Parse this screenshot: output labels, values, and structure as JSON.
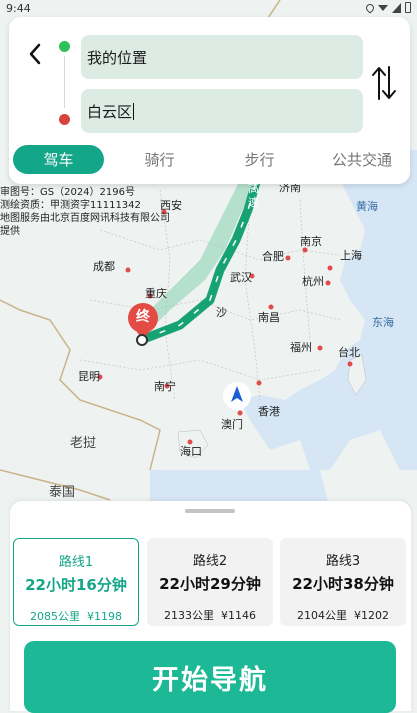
{
  "status": {
    "time": "9:44"
  },
  "search": {
    "from": "我的位置",
    "to": "白云区"
  },
  "tabs": [
    "驾车",
    "骑行",
    "步行",
    "公共交通"
  ],
  "map": {
    "copyright": [
      "审图号：GS（2024）2196号",
      "测绘资质：甲测资字11111342",
      "地图服务由北京百度网讯科技有限公司",
      "提供"
    ],
    "cities": {
      "xian": "西安",
      "chengdu": "成都",
      "chongqing": "重庆",
      "nanjing": "南京",
      "hefei": "合肥",
      "shanghai": "上海",
      "hangzhou": "杭州",
      "nanchang": "南昌",
      "wuhan": "武汉",
      "changsha": "沙",
      "fuzhou": "福州",
      "taibei": "台北",
      "kunming": "昆明",
      "nanning": "南宁",
      "aomen": "澳门",
      "xianggang": "香港",
      "haikou": "海口",
      "laos": "老挝",
      "thailand": "泰国",
      "huanghai": "黄海",
      "donghai": "东海",
      "jinan": "济南"
    },
    "highway_label": "高速",
    "end_marker": "终"
  },
  "routes": [
    {
      "name": "路线1",
      "time": "22小时16分钟",
      "distance": "2085公里",
      "cost": "¥1198",
      "selected": true
    },
    {
      "name": "路线2",
      "time": "22小时29分钟",
      "distance": "2133公里",
      "cost": "¥1146",
      "selected": false
    },
    {
      "name": "路线3",
      "time": "22小时38分钟",
      "distance": "2104公里",
      "cost": "¥1202",
      "selected": false
    }
  ],
  "start_button": "开始导航",
  "colors": {
    "accent": "#1db996",
    "route": "#17a274"
  }
}
